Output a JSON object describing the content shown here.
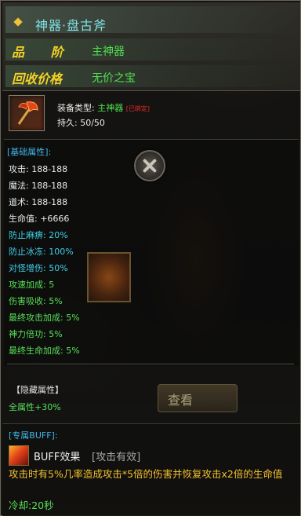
{
  "header": {
    "title": "神器·盘古斧",
    "rank_label": "品  阶",
    "rank_value": "主神器",
    "recycle_label": "回收价格",
    "recycle_value": "无价之宝"
  },
  "item": {
    "icon": "axe-icon",
    "type_label": "装备类型:",
    "type_value": "主神器",
    "type_badge": "[已绑定]",
    "durability_label": "持久:",
    "durability_value": "50/50"
  },
  "base_section": {
    "title": "[基础属性]:",
    "stats": [
      {
        "text": "攻击: 188-188",
        "color": "white"
      },
      {
        "text": "魔法: 188-188",
        "color": "white"
      },
      {
        "text": "道术: 188-188",
        "color": "white"
      },
      {
        "text": "生命值: +6666",
        "color": "white"
      },
      {
        "text": "防止麻痹: 20%",
        "color": "cyan"
      },
      {
        "text": "防止冰冻: 100%",
        "color": "cyan"
      },
      {
        "text": "对怪增伤: 50%",
        "color": "cyan"
      },
      {
        "text": "攻速加成: 5",
        "color": "green"
      },
      {
        "text": "伤害吸收: 5%",
        "color": "green"
      },
      {
        "text": "最终攻击加成: 5%",
        "color": "green"
      },
      {
        "text": "神力倍功: 5%",
        "color": "green"
      },
      {
        "text": "最终生命加成: 5%",
        "color": "green"
      }
    ]
  },
  "hidden_section": {
    "title": "【隐藏属性】",
    "value": "全属性+30%"
  },
  "background_button": {
    "label": "查看"
  },
  "buff_section": {
    "title": "[专属BUFF]:",
    "icon": "flame-icon",
    "name": "BUFF效果",
    "tag": "[攻击有效]",
    "description": "攻击时有5%几率造成攻击*5倍的伤害并恢复攻击x2倍的生命值",
    "cooldown": "冷却:20秒"
  },
  "colors": {
    "title": "#7fe0e6",
    "label_gold": "#f5d225",
    "value_green": "#4fe04f",
    "section_blue": "#3fb6ea",
    "stat_cyan": "#3fd0e8",
    "buff_yellow": "#f3c12e",
    "bound_red": "#e02a2a"
  }
}
